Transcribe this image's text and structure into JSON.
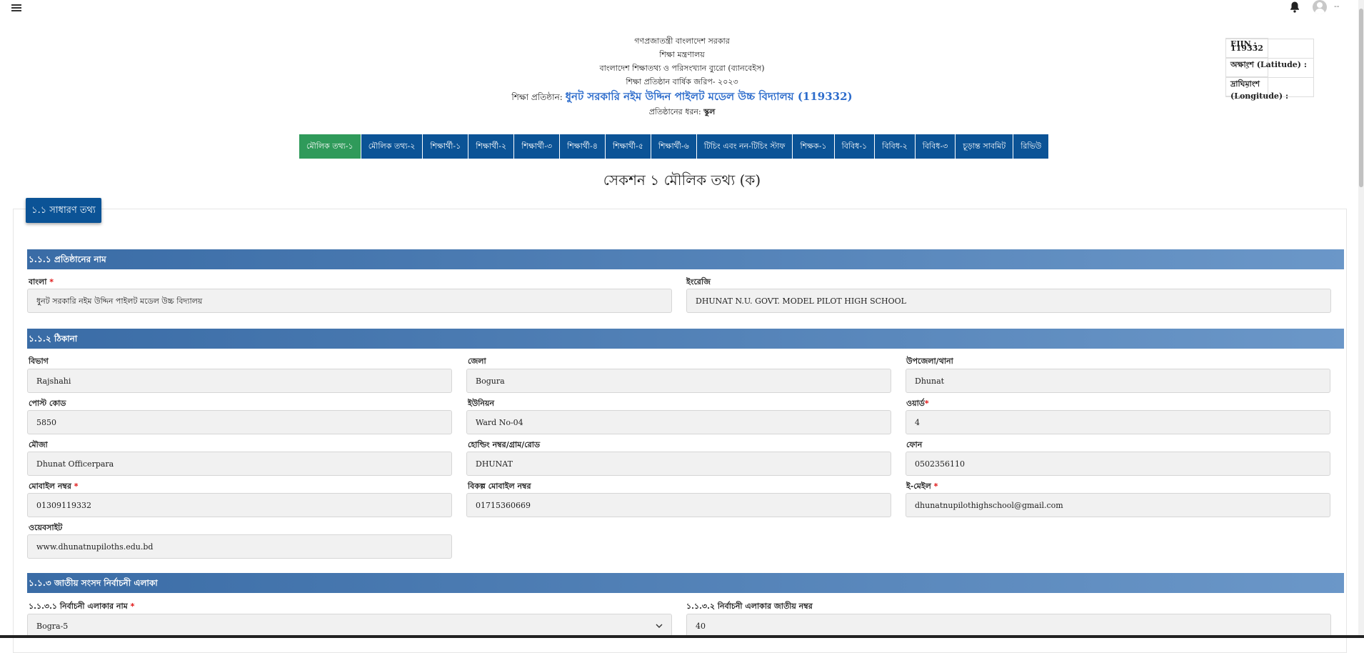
{
  "header": {
    "line1": "গণপ্রজাতন্ত্রী বাংলাদেশ সরকার",
    "line2": "শিক্ষা মন্ত্রণালয়",
    "line3": "বাংলাদেশ শিক্ষাতথ্য ও পরিসংখ্যান ব্যুরো (ব্যানবেইস)",
    "line4": "শিক্ষা প্রতিষ্ঠান বার্ষিক জরিপ- ২০২৩",
    "inst_label": "শিক্ষা প্রতিষ্ঠান:",
    "inst_name": "ধুনট সরকারি নইম উদ্দিন পাইলট মডেল উচ্চ বিদ্যালয় (119332)",
    "type_label": "প্রতিষ্ঠানের ধরন:",
    "type_value": "স্কুল"
  },
  "info_table": {
    "eiin_label": "EIIN :",
    "eiin_value": "119332",
    "lat_label": "অক্ষাংশ (Latitude) :",
    "lat_value": "-",
    "lon_label": "দ্রাঘিমাংশ (Longitude) :",
    "lon_value": "-"
  },
  "tabs": [
    {
      "label": "মৌলিক তথ্য-১",
      "active": true
    },
    {
      "label": "মৌলিক তথ্য-২"
    },
    {
      "label": "শিক্ষার্থী-১"
    },
    {
      "label": "শিক্ষার্থী-২"
    },
    {
      "label": "শিক্ষার্থী-৩"
    },
    {
      "label": "শিক্ষার্থী-৪"
    },
    {
      "label": "শিক্ষার্থী-৫"
    },
    {
      "label": "শিক্ষার্থী-৬"
    },
    {
      "label": "টিচিং এবং নন-টিচিং স্টাফ"
    },
    {
      "label": "শিক্ষক-১"
    },
    {
      "label": "বিবিধ-১"
    },
    {
      "label": "বিবিধ-২"
    },
    {
      "label": "বিবিধ-৩"
    },
    {
      "label": "চূড়ান্ত সাবমিট"
    },
    {
      "label": "রিভিউ"
    }
  ],
  "section_title": "সেকশন ১ মৌলিক তথ্য (ক)",
  "badge": "১.১ সাধারণ তথ্য",
  "s111": {
    "title": "১.১.১ প্রতিষ্ঠানের নাম",
    "bangla_label": "বাংলা",
    "bangla_value": "ধুনট সরকারি নইম উদ্দিন পাইলট মডেল উচ্চ বিদ্যালয়",
    "english_label": "ইংরেজি",
    "english_value": "DHUNAT N.U. GOVT. MODEL PILOT HIGH SCHOOL"
  },
  "s112": {
    "title": "১.১.২ ঠিকানা",
    "division_label": "বিভাগ",
    "division_value": "Rajshahi",
    "district_label": "জেলা",
    "district_value": "Bogura",
    "upazila_label": "উপজেলা/থানা",
    "upazila_value": "Dhunat",
    "postcode_label": "পোস্ট কোড",
    "postcode_value": "5850",
    "union_label": "ইউনিয়ন",
    "union_value": "Ward No-04",
    "ward_label": "ওয়ার্ড",
    "ward_value": "4",
    "mouza_label": "মৌজা",
    "mouza_value": "Dhunat Officerpara",
    "holding_label": "হোল্ডিং নম্বর/গ্রাম/রোড",
    "holding_value": "DHUNAT",
    "phone_label": "ফোন",
    "phone_value": "0502356110",
    "mobile_label": "মোবাইল নম্বর",
    "mobile_value": "01309119332",
    "alt_mobile_label": "বিকল্প মোবাইল নম্বর",
    "alt_mobile_value": "01715360669",
    "email_label": "ই-মেইল",
    "email_value": "dhunatnupilothighschool@gmail.com",
    "website_label": "ওয়েবসাইট",
    "website_value": "www.dhunatnupiloths.edu.bd"
  },
  "s113": {
    "title": "১.১.৩ জাতীয় সংসদ নির্বাচনী এলাকা",
    "area_name_label": "১.১.৩.১ নির্বাচনী এলাকার নাম",
    "area_name_value": "Bogra-5",
    "area_no_label": "১.১.৩.২ নির্বাচনী এলাকার জাতীয় নম্বর",
    "area_no_value": "40"
  },
  "required_mark": "*",
  "caret_text": "--"
}
